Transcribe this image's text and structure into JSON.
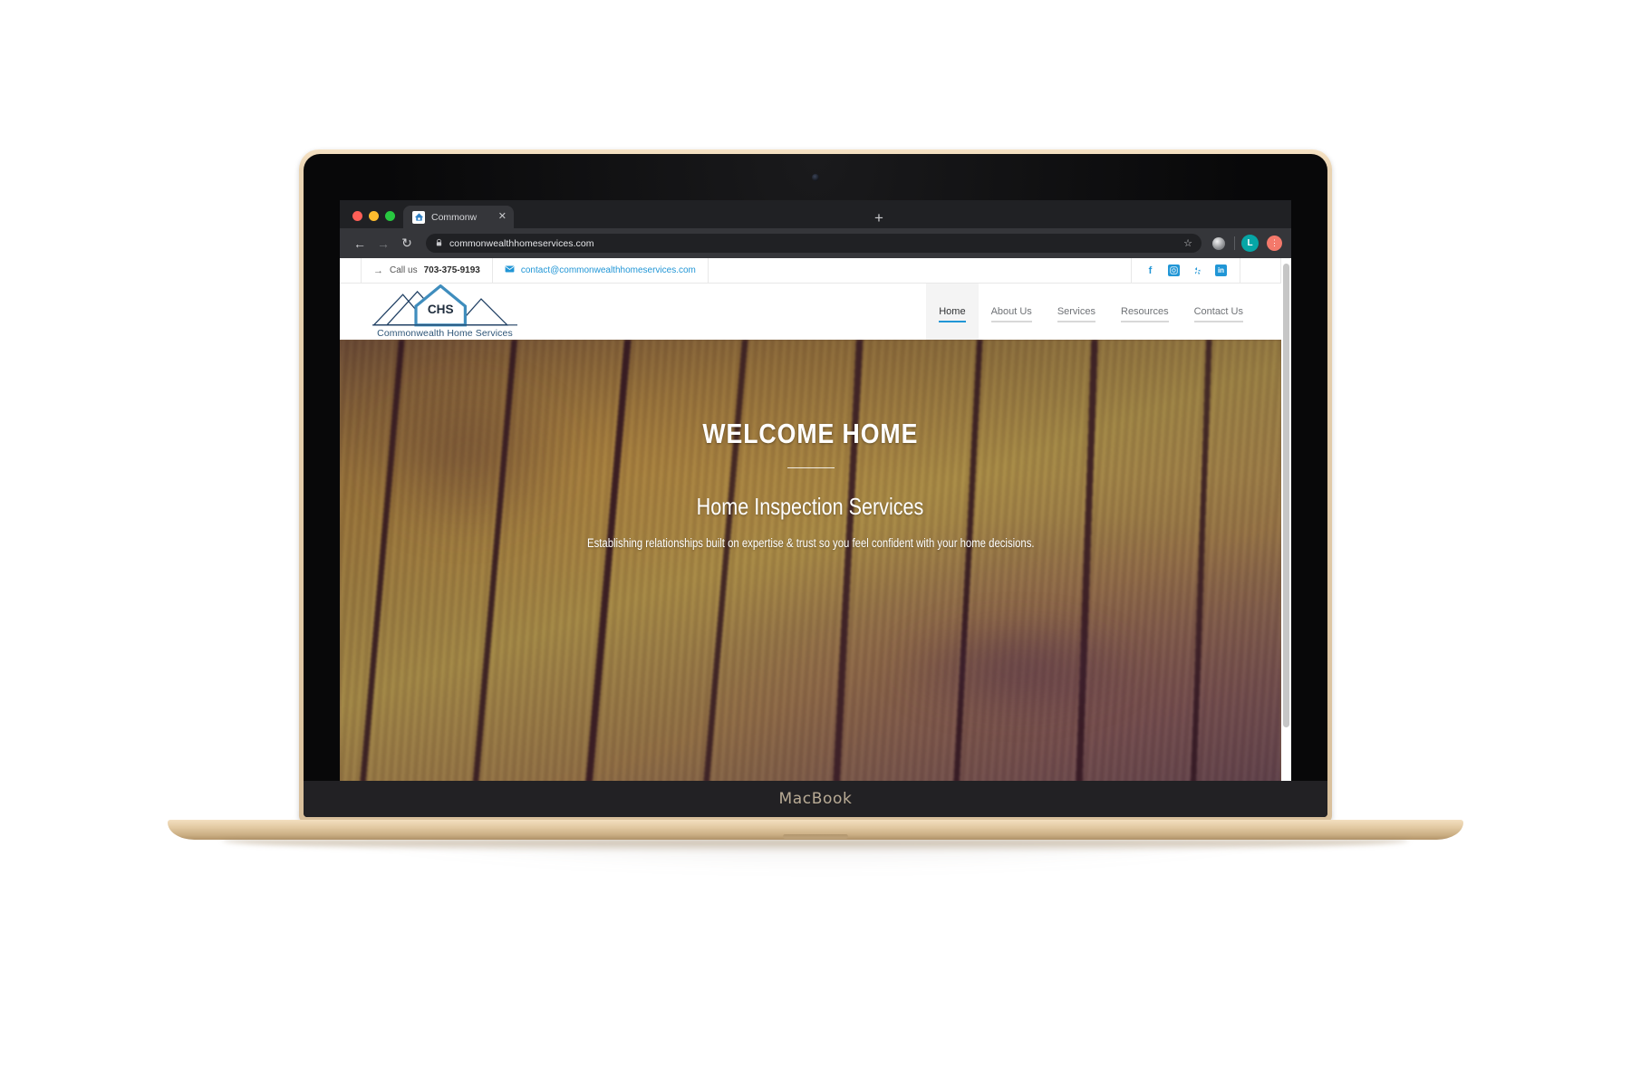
{
  "device": {
    "brand_label": "MacBook"
  },
  "browser": {
    "tab": {
      "title": "Commonw",
      "favicon": "house-icon",
      "close": "✕"
    },
    "new_tab_label": "+",
    "nav": {
      "back": "←",
      "forward": "→",
      "reload": "↻"
    },
    "omnibox": {
      "lock_icon": "lock-icon",
      "url": "commonwealthhomeservices.com",
      "bookmark_icon": "☆"
    },
    "profile_initial": "L",
    "extension_icon": "puzzle-icon"
  },
  "site": {
    "topbar": {
      "phone_prefix": "Call us",
      "phone": "703-375-9193",
      "phone_arrow": "→",
      "email": "contact@commonwealthhomeservices.com",
      "email_icon": "envelope-icon",
      "social": [
        {
          "name": "facebook",
          "glyph": "f"
        },
        {
          "name": "instagram",
          "glyph": "▣"
        },
        {
          "name": "yelp",
          "glyph": "✳"
        },
        {
          "name": "linkedin",
          "glyph": "in"
        }
      ]
    },
    "logo": {
      "monogram": "CHS",
      "caption": "Commonwealth Home Services"
    },
    "nav": [
      {
        "label": "Home",
        "active": true
      },
      {
        "label": "About Us",
        "active": false
      },
      {
        "label": "Services",
        "active": false
      },
      {
        "label": "Resources",
        "active": false
      },
      {
        "label": "Contact Us",
        "active": false
      }
    ],
    "hero": {
      "title": "WELCOME HOME",
      "subtitle": "Home Inspection Services",
      "tagline": "Establishing relationships built on expertise & trust so you feel confident with your home decisions."
    }
  },
  "colors": {
    "brand_blue": "#2196d6",
    "logo_navy": "#1f3f63",
    "nav_active_text": "#2f3133"
  }
}
